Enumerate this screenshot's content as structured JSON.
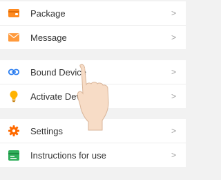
{
  "groups": [
    {
      "items": [
        {
          "label": "Package",
          "icon": "package-icon",
          "chevron": ">",
          "color": "#ff8a1f"
        },
        {
          "label": "Message",
          "icon": "envelope-icon",
          "chevron": ">",
          "color": "#ff9a3c"
        }
      ]
    },
    {
      "items": [
        {
          "label": "Bound Device",
          "icon": "link-icon",
          "chevron": ">",
          "color": "#2d7ff0"
        },
        {
          "label": "Activate Device",
          "icon": "lightbulb-icon",
          "chevron": ">",
          "color": "#ffb300"
        }
      ]
    },
    {
      "items": [
        {
          "label": "Settings",
          "icon": "gear-icon",
          "chevron": ">",
          "color": "#ff6a00"
        },
        {
          "label": "Instructions for use",
          "icon": "manual-icon",
          "chevron": ">",
          "color": "#2fae5a"
        }
      ]
    }
  ]
}
